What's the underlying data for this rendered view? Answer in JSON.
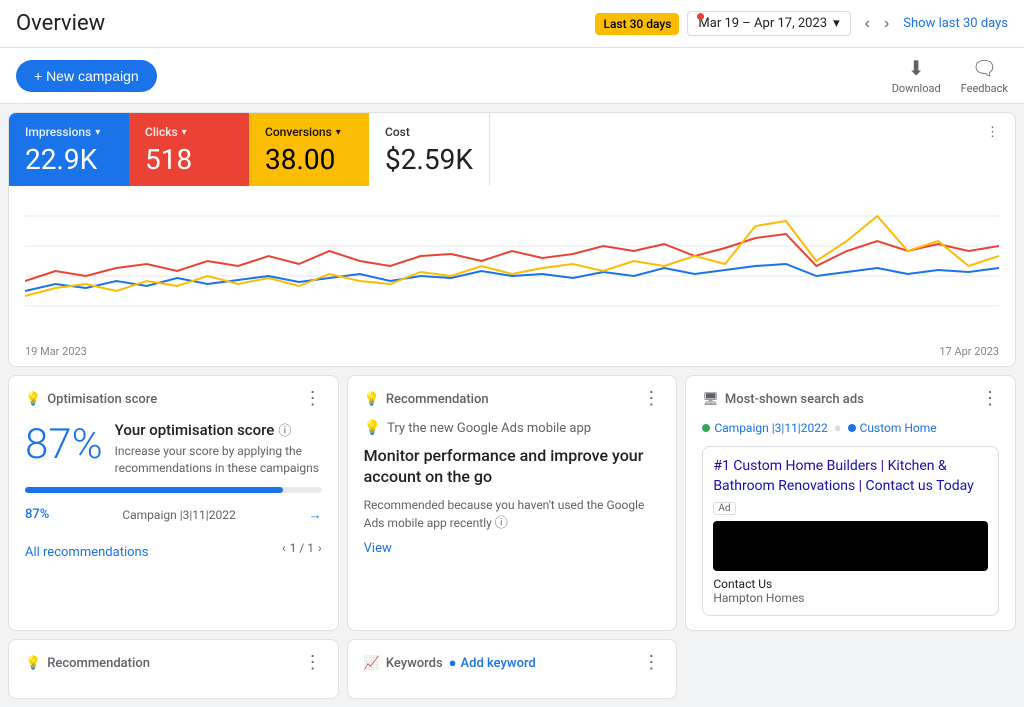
{
  "header": {
    "title": "Overview",
    "notification_dot": true,
    "date_badge": "Last 30 days",
    "date_range": "Mar 19 – Apr 17, 2023",
    "show_last_30": "Show last 30 days"
  },
  "toolbar": {
    "new_campaign_label": "+ New campaign",
    "download_label": "Download",
    "feedback_label": "Feedback"
  },
  "stats": {
    "impressions": {
      "label": "Impressions",
      "value": "22.9K"
    },
    "clicks": {
      "label": "Clicks",
      "value": "518"
    },
    "conversions": {
      "label": "Conversions",
      "value": "38.00"
    },
    "cost": {
      "label": "Cost",
      "value": "$2.59K"
    }
  },
  "chart": {
    "start_label": "19 Mar 2023",
    "end_label": "17 Apr 2023"
  },
  "optimisation_panel": {
    "title": "Optimisation score",
    "score_big": "87%",
    "score_title": "Your optimisation score",
    "score_desc": "Increase your score by applying the recommendations in these campaigns",
    "progress": 87,
    "campaign_score": "87%",
    "campaign_name": "Campaign |3|11|2022",
    "all_recommendations": "All recommendations",
    "pagination": "1 / 1"
  },
  "recommendation_panel": {
    "title": "Recommendation",
    "hint": "Try the new Google Ads mobile app",
    "rec_title": "Monitor performance and improve your account on the go",
    "rec_desc": "Recommended because you haven't used the Google Ads mobile app recently",
    "view_label": "View"
  },
  "search_ads_panel": {
    "title": "Most-shown search ads",
    "campaign_tag1": "Campaign |3|11|2022",
    "campaign_tag2": "Custom Home",
    "ad_title": "#1 Custom Home Builders | Kitchen & Bathroom Renovations | Contact us Today",
    "ad_badge": "Ad",
    "ad_link": "Contact Us",
    "ad_company": "Hampton Homes"
  },
  "keywords_panel": {
    "title": "Keywords",
    "add_keyword_label": "Add keyword"
  },
  "recommendation_bottom": {
    "title": "Recommendation"
  }
}
